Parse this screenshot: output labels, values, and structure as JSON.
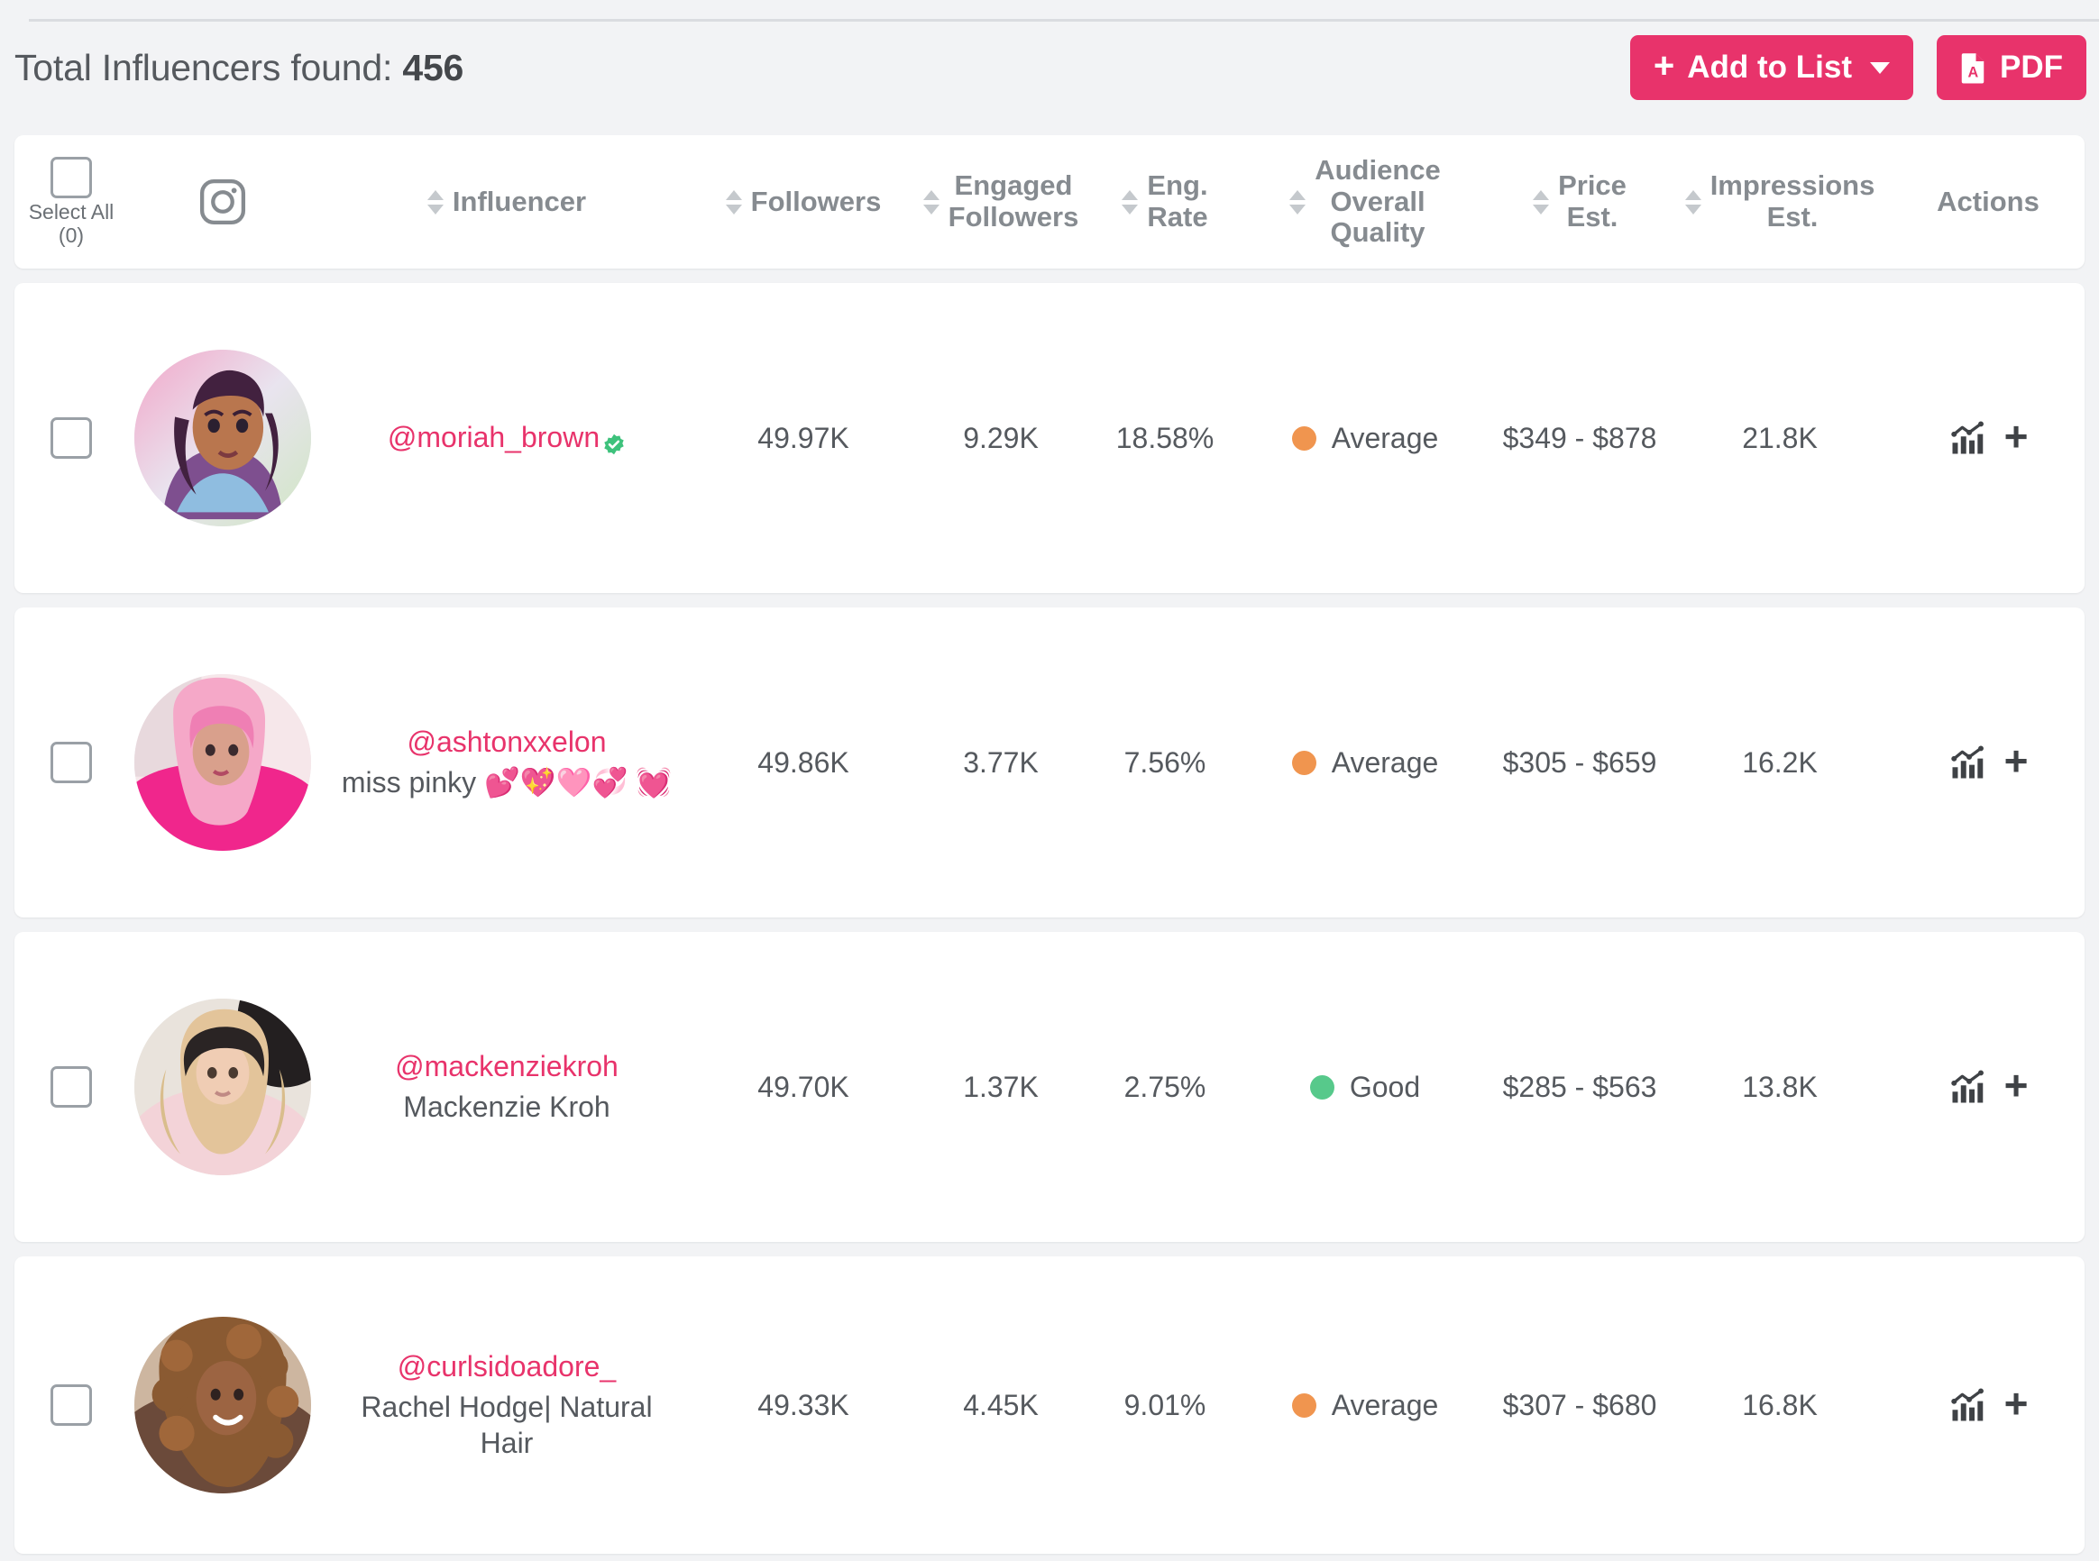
{
  "toolbar": {
    "total_label": "Total Influencers found:",
    "total_count": "456",
    "add_to_list_label": "Add to List",
    "pdf_label": "PDF"
  },
  "table": {
    "select_all_label": "Select All\n(0)",
    "platform_icon": "instagram-icon",
    "columns": [
      {
        "key": "influencer",
        "label": "Influencer",
        "sortable": true
      },
      {
        "key": "followers",
        "label": "Followers",
        "sortable": true
      },
      {
        "key": "engaged",
        "label": "Engaged\nFollowers",
        "sortable": true
      },
      {
        "key": "eng_rate",
        "label": "Eng.\nRate",
        "sortable": true
      },
      {
        "key": "quality",
        "label": "Audience\nOverall\nQuality",
        "sortable": true
      },
      {
        "key": "price",
        "label": "Price\nEst.",
        "sortable": true
      },
      {
        "key": "impressions",
        "label": "Impressions\nEst.",
        "sortable": true
      },
      {
        "key": "actions",
        "label": "Actions",
        "sortable": false
      }
    ],
    "rows": [
      {
        "handle": "@moriah_brown",
        "verified": true,
        "display_name": "",
        "followers": "49.97K",
        "engaged_followers": "9.29K",
        "eng_rate": "18.58%",
        "quality": "Average",
        "quality_color": "#f0954f",
        "price_est": "$349 - $878",
        "impressions_est": "21.8K"
      },
      {
        "handle": "@ashtonxxelon",
        "verified": false,
        "display_name": "miss pinky 💕💖🩷💞 💓",
        "followers": "49.86K",
        "engaged_followers": "3.77K",
        "eng_rate": "7.56%",
        "quality": "Average",
        "quality_color": "#f0954f",
        "price_est": "$305 - $659",
        "impressions_est": "16.2K"
      },
      {
        "handle": "@mackenziekroh",
        "verified": false,
        "display_name": "Mackenzie Kroh",
        "followers": "49.70K",
        "engaged_followers": "1.37K",
        "eng_rate": "2.75%",
        "quality": "Good",
        "quality_color": "#57c98b",
        "price_est": "$285 - $563",
        "impressions_est": "13.8K"
      },
      {
        "handle": "@curlsidoadore_",
        "verified": false,
        "display_name": "Rachel Hodge| Natural Hair",
        "followers": "49.33K",
        "engaged_followers": "4.45K",
        "eng_rate": "9.01%",
        "quality": "Average",
        "quality_color": "#f0954f",
        "price_est": "$307 - $680",
        "impressions_est": "16.8K"
      }
    ]
  },
  "theme": {
    "accent": "#e8336b",
    "good": "#57c98b",
    "average": "#f0954f",
    "background": "#f2f3f5"
  }
}
